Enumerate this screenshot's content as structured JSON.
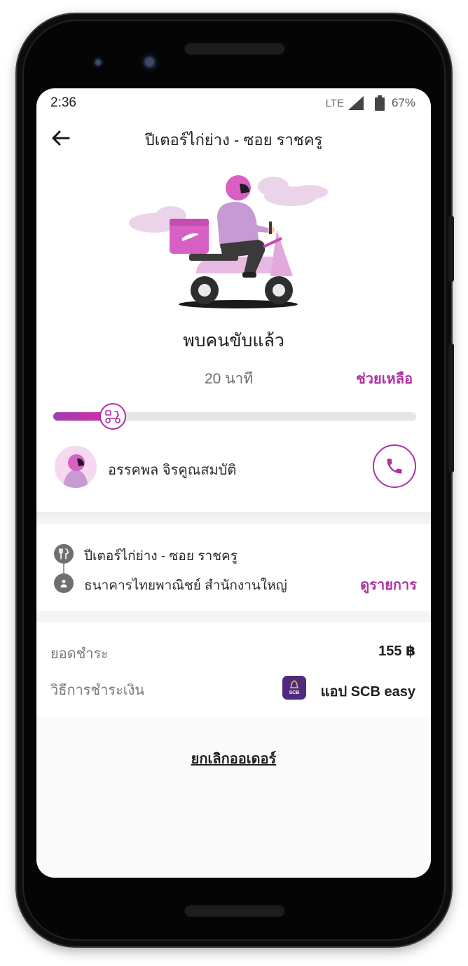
{
  "status_bar": {
    "time": "2:36",
    "network": "LTE",
    "battery": "67%"
  },
  "header": {
    "back_icon": "arrow-left-icon",
    "title": "ปีเตอร์ไก่ย่าง - ซอย ราชครู"
  },
  "order_status": {
    "title": "พบคนขับแล้ว",
    "eta": "20 นาที",
    "help_label": "ช่วยเหลือ",
    "progress": 0.16
  },
  "driver": {
    "name": "อรรคพล จิรคูณสมบัติ",
    "call_icon": "phone-icon"
  },
  "route": {
    "pickup": "ปีเตอร์ไก่ย่าง - ซอย ราชครู",
    "dropoff": "ธนาคารไทยพาณิชย์ สำนักงานใหญ่",
    "details_label": "ดูรายการ"
  },
  "payment": {
    "total_label": "ยอดชำระ",
    "total_value": "155 ฿",
    "method_label": "วิธีการชำระเงิน",
    "method_value": "แอป SCB easy",
    "method_icon_text": "SCB"
  },
  "cancel_label": "ยกเลิกออเดอร์",
  "colors": {
    "accent": "#b02fa5",
    "progress_start": "#9b3fb1",
    "progress_end": "#d42fa2"
  }
}
